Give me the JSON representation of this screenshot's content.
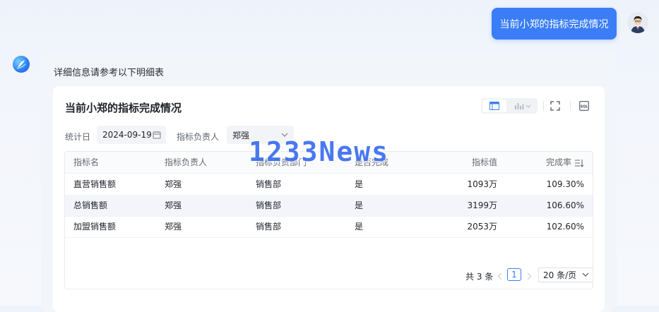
{
  "user_message": "当前小郑的指标完成情况",
  "bot": {
    "intro": "详细信息请参考以下明细表"
  },
  "card": {
    "title": "当前小郑的指标完成情况",
    "toolbar": {
      "table_view_icon": "table-icon",
      "chart_view_icon": "bar-chart-icon",
      "fullscreen_icon": "fullscreen-icon",
      "sql_icon": "sql-icon"
    },
    "filters": {
      "date_label": "统计日",
      "date_value": "2024-09-19",
      "owner_label": "指标负责人",
      "owner_value": "郑强"
    },
    "table": {
      "columns": [
        "指标名",
        "指标负责人",
        "指标负责部门",
        "是否完成",
        "指标值",
        "完成率"
      ],
      "rows": [
        [
          "直营销售额",
          "郑强",
          "销售部",
          "是",
          "1093万",
          "109.30%"
        ],
        [
          "总销售额",
          "郑强",
          "销售部",
          "是",
          "3199万",
          "106.60%"
        ],
        [
          "加盟销售额",
          "郑强",
          "销售部",
          "是",
          "2053万",
          "102.60%"
        ]
      ]
    },
    "pagination": {
      "total": "共 3 条",
      "current_page": "1",
      "page_size": "20 条/页"
    }
  },
  "watermark": "1233News",
  "colors": {
    "accent": "#3a7df6",
    "row_highlight": "#f3f5fb"
  }
}
